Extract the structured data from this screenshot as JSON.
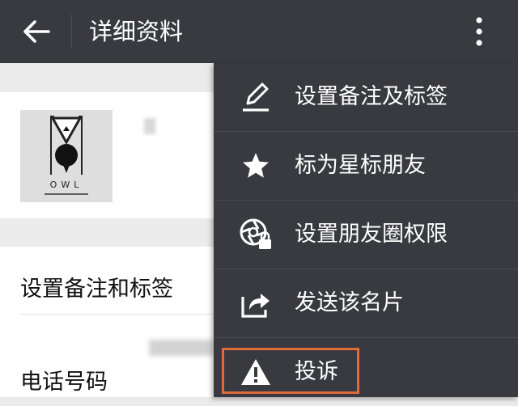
{
  "header": {
    "title": "详细资料",
    "back_icon": "arrow-left-icon",
    "more_icon": "more-vertical-icon"
  },
  "profile": {
    "avatar_text": "OWL"
  },
  "rows": [
    {
      "label": "设置备注和标签"
    },
    {
      "label": "电话号码"
    }
  ],
  "menu": {
    "items": [
      {
        "label": "设置备注及标签",
        "icon": "pencil-icon"
      },
      {
        "label": "标为星标朋友",
        "icon": "star-icon"
      },
      {
        "label": "设置朋友圈权限",
        "icon": "moments-lock-icon"
      },
      {
        "label": "发送该名片",
        "icon": "share-icon"
      },
      {
        "label": "投诉",
        "icon": "warning-icon"
      }
    ]
  },
  "colors": {
    "topbar": "#393a3f",
    "menu": "#393a3f",
    "highlight": "#e06a3b",
    "background": "#ebebeb"
  }
}
